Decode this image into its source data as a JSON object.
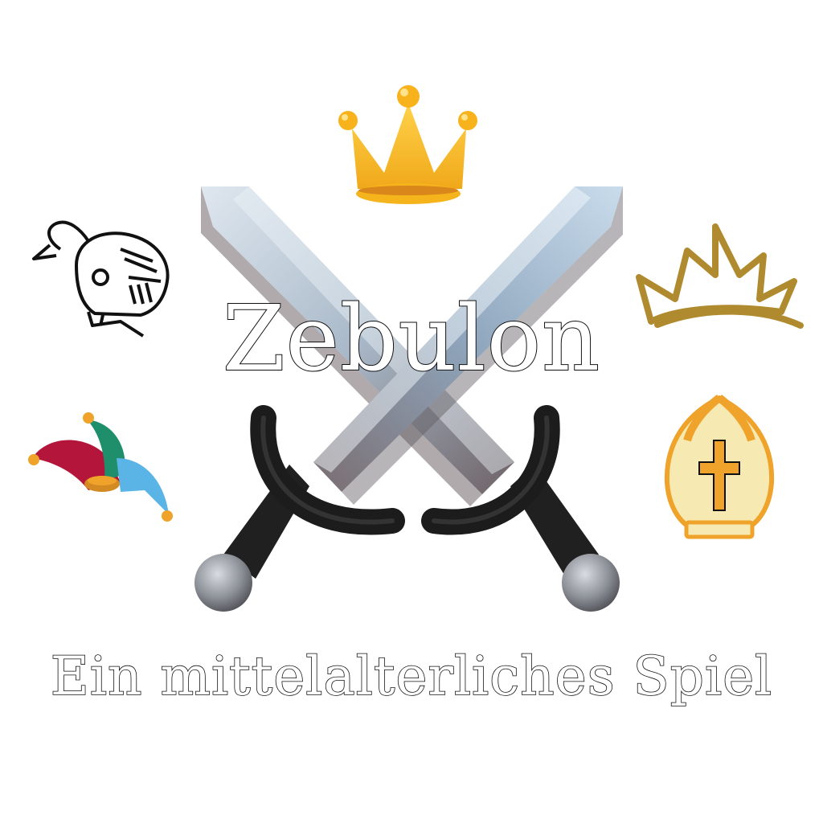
{
  "title": "Zebulon",
  "subtitle": "Ein mittelalterliches Spiel",
  "icons": [
    "crossed-swords-icon",
    "gold-crown-icon",
    "knight-helmet-icon",
    "white-gold-crown-icon",
    "jester-hat-icon",
    "bishop-mitre-icon"
  ],
  "colors": {
    "background": "#ffffff",
    "text_outline": "#111111",
    "crown_gold": "#f2b51a",
    "crown_outline_gold": "#b08a2e",
    "jester_red": "#b3163a",
    "jester_green": "#1f8f6b",
    "jester_blue": "#5ab4e6",
    "mitre_cream": "#f6eab2",
    "mitre_orange": "#f0a32a"
  }
}
